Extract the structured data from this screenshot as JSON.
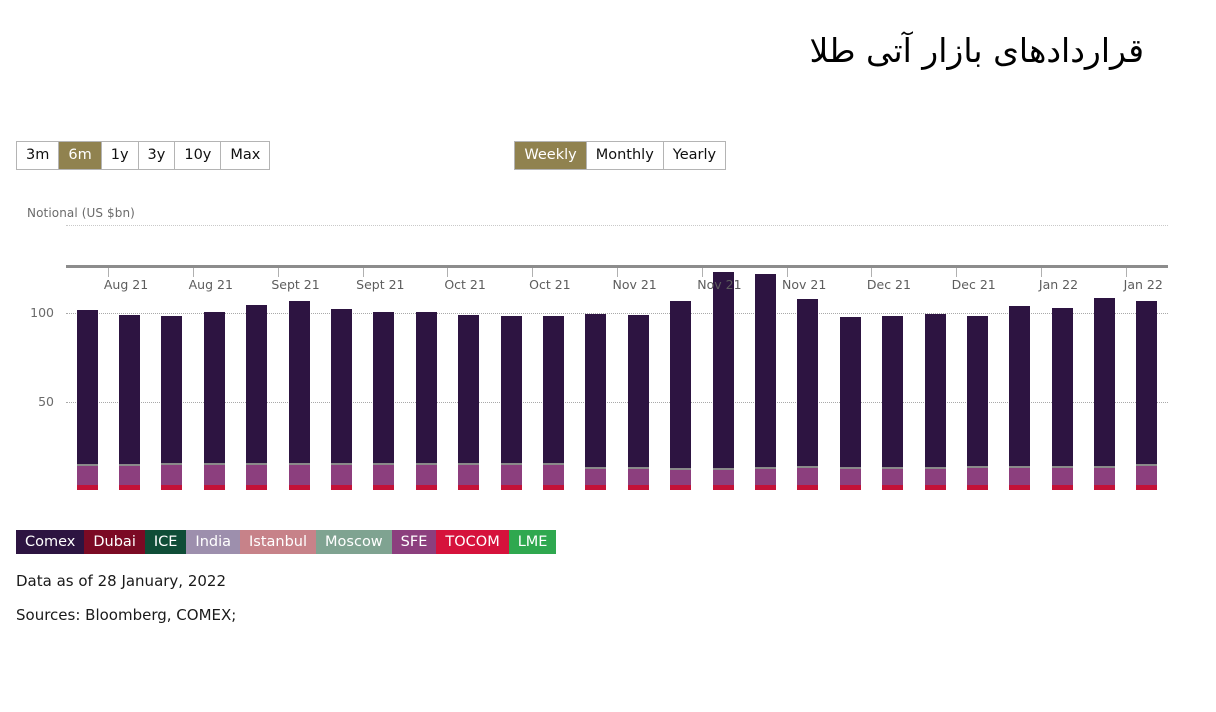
{
  "header": {
    "title": "قراردادهای بازار آتی طلا"
  },
  "controls": {
    "range": {
      "options": [
        "3m",
        "6m",
        "1y",
        "3y",
        "10y",
        "Max"
      ],
      "selected": "6m"
    },
    "frequency": {
      "options": [
        "Weekly",
        "Monthly",
        "Yearly"
      ],
      "selected": "Weekly"
    }
  },
  "chart_data": {
    "type": "bar",
    "title": "قراردادهای بازار آتی طلا",
    "subtype": "stacked",
    "ylabel": "Notional (US $bn)",
    "xlabel": "",
    "ylim": [
      0,
      150
    ],
    "yticks": [
      50,
      100
    ],
    "ytick_labels": [
      "50",
      "100"
    ],
    "grid": true,
    "legend_position": "bottom-left",
    "categories": [
      "Aug 21",
      "Aug 21",
      "Aug 21",
      "Aug 21",
      "Sept 21",
      "Sept 21",
      "Sept 21",
      "Sept 21",
      "Oct 21",
      "Oct 21",
      "Oct 21",
      "Oct 21",
      "Nov 21",
      "Nov 21",
      "Nov 21",
      "Nov 21",
      "Nov 21",
      "Dec 21",
      "Dec 21",
      "Dec 21",
      "Dec 21",
      "Jan 22",
      "Jan 22",
      "Jan 22",
      "Jan 22",
      "Jan 22"
    ],
    "xtick_labels": [
      "Aug 21",
      "Aug 21",
      "Sept 21",
      "Sept 21",
      "Oct 21",
      "Oct 21",
      "Nov 21",
      "Nov 21",
      "Nov 21",
      "Dec 21",
      "Dec 21",
      "Jan 22",
      "Jan 22"
    ],
    "series": [
      {
        "name": "Comex",
        "color": "#2d1441",
        "values": [
          88.5,
          85.5,
          84.5,
          87.0,
          91.0,
          93.0,
          88.5,
          87.0,
          86.5,
          85.0,
          84.5,
          84.5,
          87.5,
          87.0,
          95.5,
          112.0,
          110.0,
          95.5,
          86.0,
          86.5,
          87.5,
          86.0,
          91.5,
          90.5,
          96.0,
          93.5
        ]
      },
      {
        "name": "SFE",
        "color": "#8c3f7e",
        "values": [
          10.5,
          10.5,
          11.0,
          11.0,
          11.0,
          11.0,
          11.0,
          11.0,
          11.0,
          11.0,
          11.0,
          11.0,
          9.0,
          9.0,
          8.5,
          8.5,
          9.0,
          9.5,
          9.0,
          9.0,
          9.0,
          9.5,
          9.5,
          9.5,
          9.5,
          10.5
        ]
      },
      {
        "name": "TOCOM",
        "color": "#c41238",
        "values": [
          3.0,
          3.0,
          3.0,
          3.0,
          3.0,
          3.0,
          3.0,
          3.0,
          3.0,
          3.0,
          3.0,
          3.0,
          3.0,
          3.0,
          3.0,
          3.0,
          3.0,
          3.0,
          3.0,
          3.0,
          3.0,
          3.0,
          3.0,
          3.0,
          3.0,
          3.0
        ]
      }
    ],
    "totals": [
      102.0,
      99.0,
      98.5,
      101.0,
      105.0,
      107.0,
      102.5,
      101.0,
      100.5,
      99.0,
      98.5,
      98.5,
      99.5,
      99.0,
      107.0,
      123.5,
      122.0,
      108.0,
      98.0,
      98.5,
      99.5,
      98.5,
      104.0,
      103.0,
      108.5,
      107.0
    ]
  },
  "legend": {
    "items": [
      {
        "label": "Comex",
        "color": "#2d1441"
      },
      {
        "label": "Dubai",
        "color": "#7b0a24"
      },
      {
        "label": "ICE",
        "color": "#0f4d37"
      },
      {
        "label": "India",
        "color": "#9d8fad"
      },
      {
        "label": "Istanbul",
        "color": "#c78289"
      },
      {
        "label": "Moscow",
        "color": "#7fa391"
      },
      {
        "label": "SFE",
        "color": "#8c3f7e"
      },
      {
        "label": "TOCOM",
        "color": "#d6123c"
      },
      {
        "label": "LME",
        "color": "#2fa84f"
      }
    ]
  },
  "footer": {
    "data_as_of": "Data as of 28 January, 2022",
    "sources": "Sources: Bloomberg, COMEX;"
  },
  "theme": {
    "accent": "#90824f",
    "axis_text": "#5d5d5d",
    "gridline": "#a9a9a9",
    "baseline": "#8c8c8c"
  }
}
